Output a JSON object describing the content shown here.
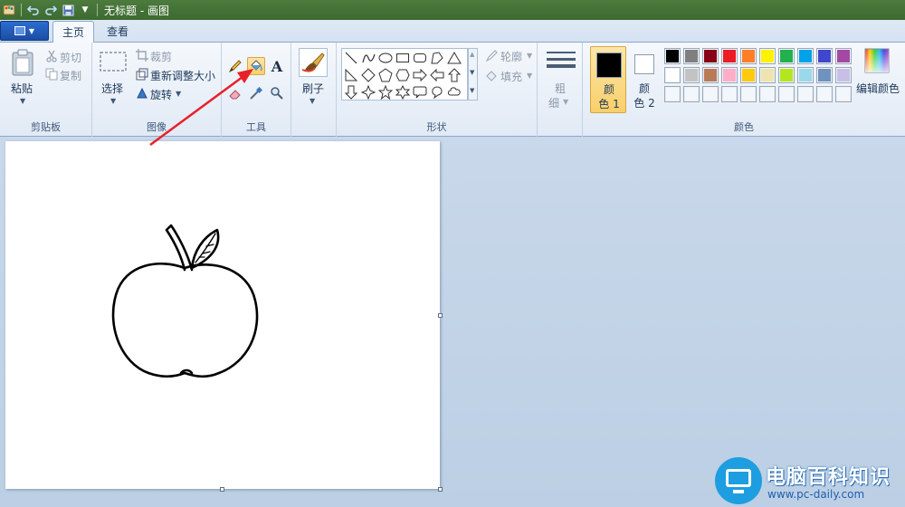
{
  "window": {
    "title": "无标题 - 画图"
  },
  "quick_access": {
    "icons": [
      "paint-app-icon",
      "undo-icon",
      "redo-icon",
      "save-icon",
      "customize-qat-icon"
    ]
  },
  "tabs": {
    "file_button": "file-menu",
    "home": "主页",
    "view": "查看"
  },
  "ribbon": {
    "clipboard": {
      "paste": "粘贴",
      "cut": "剪切",
      "copy": "复制",
      "group": "剪贴板"
    },
    "image": {
      "select": "选择",
      "crop": "裁剪",
      "resize": "重新调整大小",
      "rotate": "旋转",
      "group": "图像"
    },
    "tools": {
      "group": "工具",
      "items": [
        "pencil-icon",
        "fill-bucket-icon",
        "text-icon",
        "eraser-icon",
        "color-picker-icon",
        "magnifier-icon"
      ],
      "selected": "fill-bucket-icon"
    },
    "brushes": {
      "label": "刷子"
    },
    "shapes": {
      "group": "形状",
      "outline": "轮廓",
      "fill": "填充"
    },
    "size": {
      "label_top": "粗",
      "label_bottom": "细"
    },
    "colors": {
      "group": "颜色",
      "color1_top": "颜",
      "color1_bottom": "色 1",
      "color2_top": "颜",
      "color2_bottom": "色 2",
      "color1_value": "#000000",
      "color2_value": "#ffffff",
      "edit": "编辑颜色",
      "palette_row1": [
        "#000000",
        "#7f7f7f",
        "#880015",
        "#ed1c24",
        "#ff7f27",
        "#fff200",
        "#22b14c",
        "#00a2e8",
        "#3f48cc",
        "#a349a4"
      ],
      "palette_row2": [
        "#ffffff",
        "#c3c3c3",
        "#b97a57",
        "#ffaec9",
        "#ffc90e",
        "#efe4b0",
        "#b5e61d",
        "#99d9ea",
        "#7092be",
        "#c8bfe7"
      ],
      "palette_row3": [
        "",
        "",
        "",
        "",
        "",
        "",
        "",
        "",
        "",
        ""
      ]
    }
  },
  "annotation": {
    "arrow_color": "#e8202a"
  },
  "watermark": {
    "title": "电脑百科知识",
    "url": "www.pc-daily.com"
  }
}
